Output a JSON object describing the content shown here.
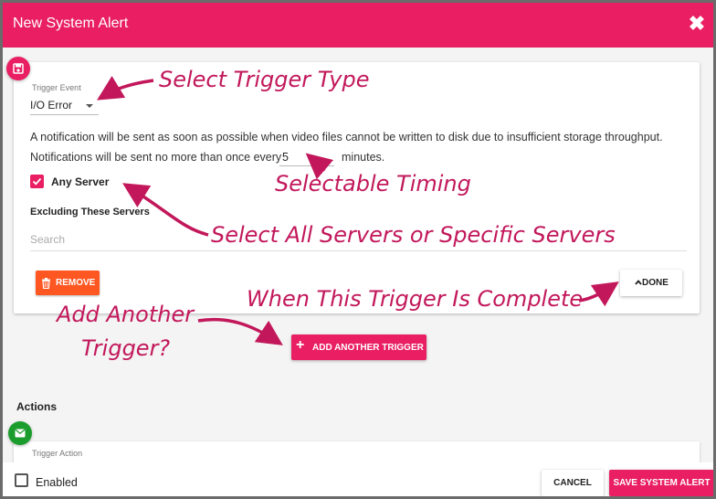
{
  "dialog": {
    "title": "New System Alert",
    "close_icon": "close-icon"
  },
  "trigger": {
    "event_label": "Trigger Event",
    "event_value": "I/O Error",
    "description": "A notification will be sent as soon as possible when video files cannot be written to disk due to insufficient storage throughput.",
    "notif_prefix": "Notifications will be sent no more than once every",
    "minutes_value": "5",
    "minutes_suffix": "minutes.",
    "any_server_label": "Any Server",
    "any_server_checked": true,
    "excluding_label": "Excluding These Servers",
    "search_placeholder": "Search",
    "remove_label": "REMOVE",
    "done_label": "DONE"
  },
  "add_trigger_label": "ADD ANOTHER TRIGGER",
  "actions": {
    "heading": "Actions",
    "trigger_action_label": "Trigger Action"
  },
  "footer": {
    "enabled_label": "Enabled",
    "enabled_checked": false,
    "cancel_label": "CANCEL",
    "save_label": "SAVE SYSTEM ALERT"
  },
  "annotations": {
    "select_trigger_type": "Select Trigger Type",
    "selectable_timing": "Selectable Timing",
    "select_servers": "Select All Servers or Specific Servers",
    "trigger_complete": "When This Trigger Is Complete",
    "add_another_line1": "Add Another",
    "add_another_line2": "Trigger?"
  },
  "colors": {
    "accent": "#e91e63",
    "remove": "#ff5722",
    "action_icon": "#1a9d2c"
  }
}
